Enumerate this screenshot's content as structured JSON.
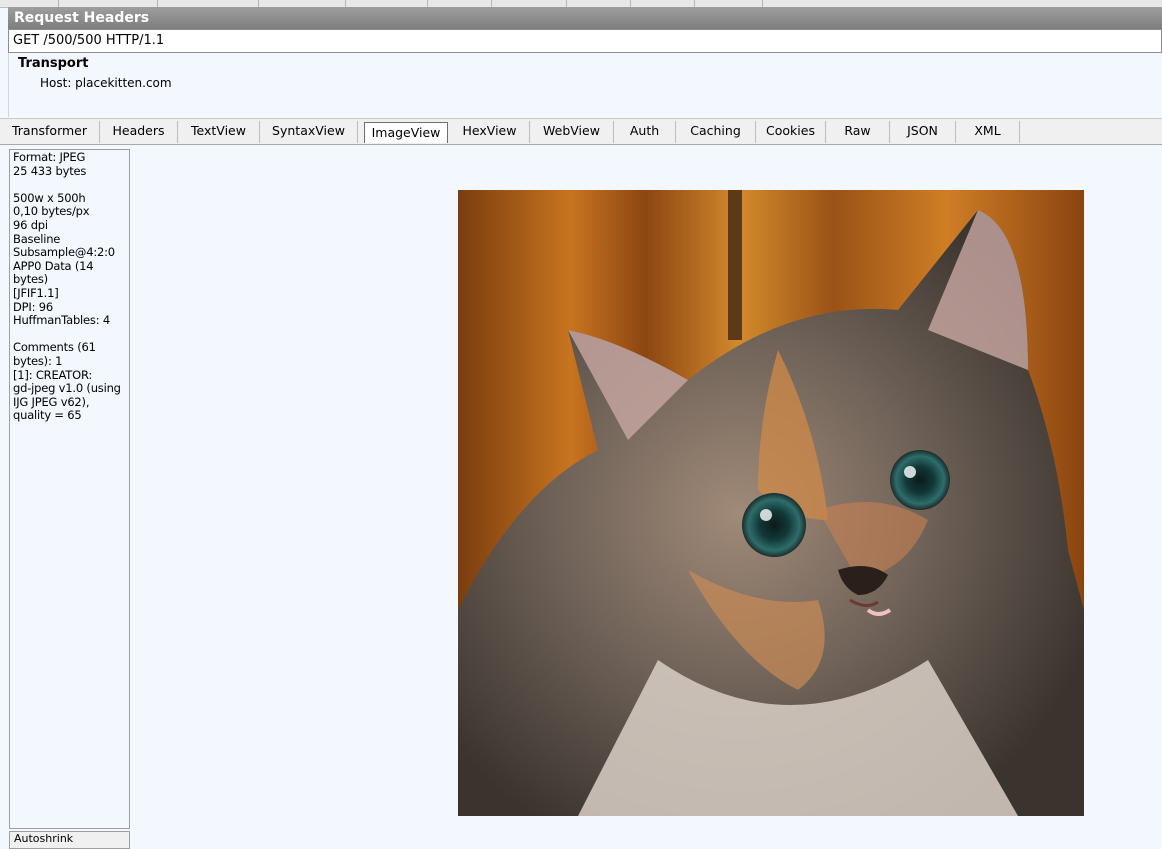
{
  "request": {
    "title": "Request Headers",
    "request_line": "GET /500/500 HTTP/1.1",
    "section_label": "Transport",
    "host": "Host: placekitten.com"
  },
  "tabs": [
    {
      "label": "Transformer"
    },
    {
      "label": "Headers"
    },
    {
      "label": "TextView"
    },
    {
      "label": "SyntaxView"
    },
    {
      "label": "ImageView",
      "active": true
    },
    {
      "label": "HexView"
    },
    {
      "label": "WebView"
    },
    {
      "label": "Auth"
    },
    {
      "label": "Caching"
    },
    {
      "label": "Cookies"
    },
    {
      "label": "Raw"
    },
    {
      "label": "JSON"
    },
    {
      "label": "XML"
    }
  ],
  "image_info": [
    "Format: JPEG",
    "25 433 bytes",
    "",
    "500w x 500h",
    "0,10 bytes/px",
    "96 dpi",
    "Baseline",
    "Subsample@4:2:0",
    "APP0 Data (14",
    "bytes)",
    "[JFIF1.1]",
    "DPI: 96",
    "HuffmanTables: 4",
    "",
    "Comments (61",
    "bytes): 1",
    "[1]: CREATOR:",
    "gd-jpeg v1.0 (using",
    "IJG JPEG v62),",
    "quality = 65"
  ],
  "autoshrink_label": "Autoshrink",
  "image": {
    "subject": "kitten photo"
  },
  "colors": {
    "header_bar": "#8a8a8a",
    "panel_bg": "#f3f8fe"
  }
}
